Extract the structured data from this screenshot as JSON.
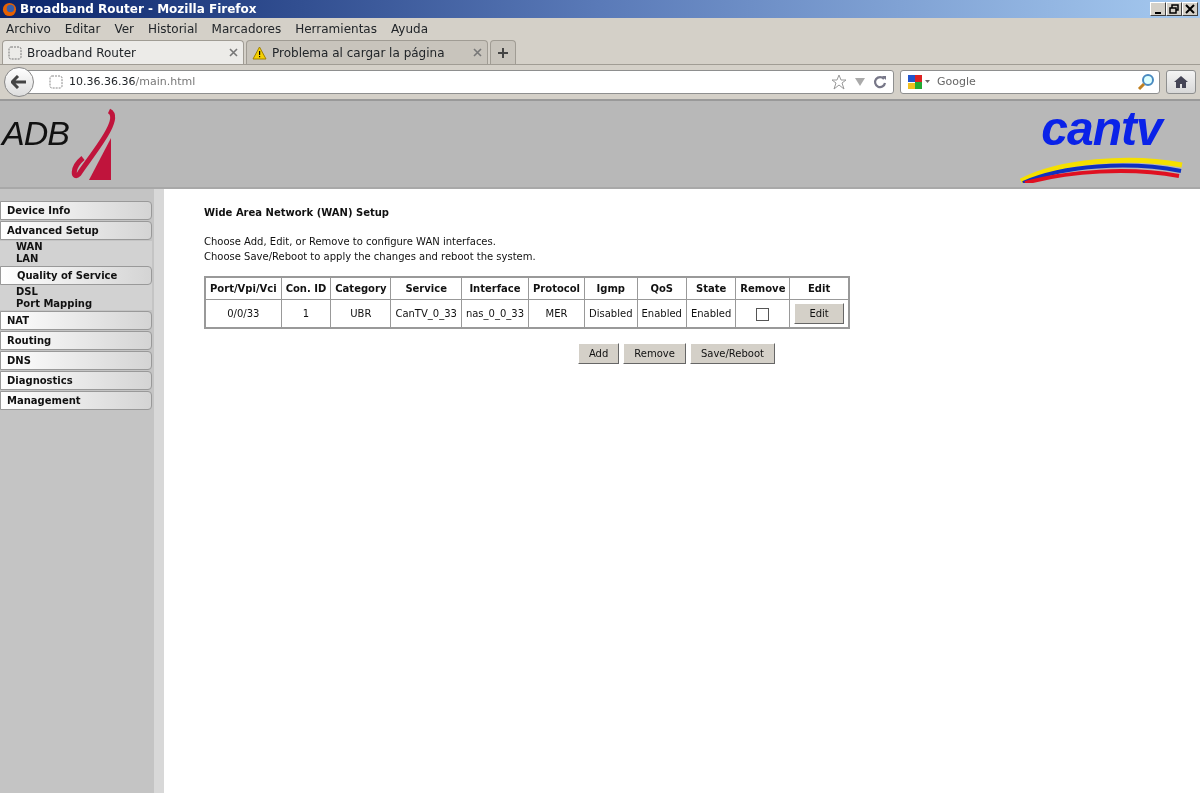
{
  "window": {
    "title": "Broadband Router - Mozilla Firefox"
  },
  "menu": [
    "Archivo",
    "Editar",
    "Ver",
    "Historial",
    "Marcadores",
    "Herramientas",
    "Ayuda"
  ],
  "tabs": [
    {
      "label": "Broadband Router",
      "selected": true,
      "kind": "page"
    },
    {
      "label": "Problema al cargar la página",
      "selected": false,
      "kind": "warning"
    }
  ],
  "address": {
    "host": "10.36.36.36",
    "path": "/main.html"
  },
  "search": {
    "placeholder": "Google"
  },
  "header": {
    "left_logo": "ADB",
    "right_logo": "cantv"
  },
  "sidebar": {
    "items": [
      {
        "label": "Device Info"
      },
      {
        "label": "Advanced Setup",
        "children": [
          {
            "label": "WAN",
            "kind": "link"
          },
          {
            "label": "LAN",
            "kind": "link"
          },
          {
            "label": "Quality of Service",
            "kind": "tab"
          },
          {
            "label": "DSL",
            "kind": "link"
          },
          {
            "label": "Port Mapping",
            "kind": "link"
          }
        ]
      },
      {
        "label": "NAT"
      },
      {
        "label": "Routing"
      },
      {
        "label": "DNS"
      },
      {
        "label": "Diagnostics"
      },
      {
        "label": "Management"
      }
    ]
  },
  "content": {
    "title": "Wide Area Network (WAN) Setup",
    "lines": [
      "Choose Add, Edit, or Remove to configure WAN interfaces.",
      "Choose Save/Reboot to apply the changes and reboot the system."
    ],
    "table": {
      "columns": [
        "Port/Vpi/Vci",
        "Con. ID",
        "Category",
        "Service",
        "Interface",
        "Protocol",
        "Igmp",
        "QoS",
        "State",
        "Remove",
        "Edit"
      ],
      "rows": [
        {
          "cells": [
            "0/0/33",
            "1",
            "UBR",
            "CanTV_0_33",
            "nas_0_0_33",
            "MER",
            "Disabled",
            "Enabled",
            "Enabled"
          ],
          "remove_checked": false,
          "edit": "Edit"
        }
      ]
    },
    "buttons": [
      "Add",
      "Remove",
      "Save/Reboot"
    ]
  }
}
